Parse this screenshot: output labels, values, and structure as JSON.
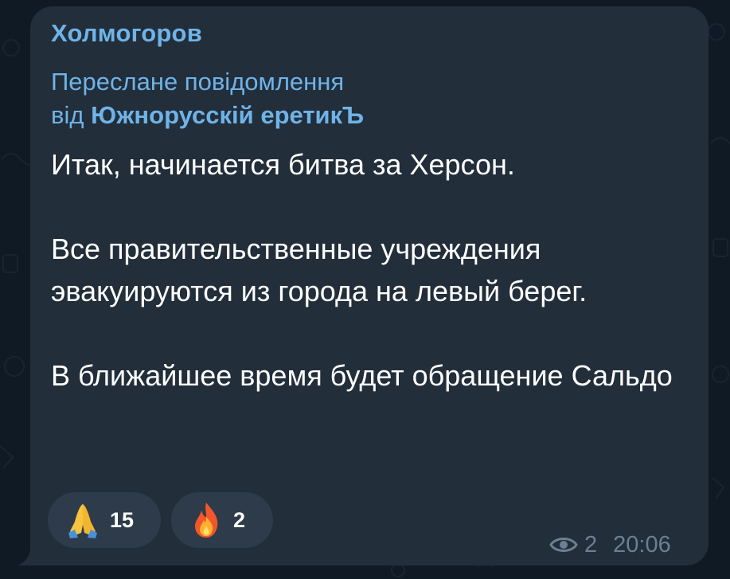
{
  "message": {
    "sender_name": "Холмогоров",
    "forward_label": "Переслане повідомлення",
    "forward_from_prefix": "від",
    "forward_from_name": "Южнорусскій еретикЪ",
    "text": "Итак, начинается битва за Херсон.\n\nВсе правительственные учреждения эвакуируются из города на левый берег.\n\nВ ближайшее время будет обращение Сальдо"
  },
  "reactions": [
    {
      "emoji": "folded-hands-icon",
      "count": "15"
    },
    {
      "emoji": "fire-icon",
      "count": "2"
    }
  ],
  "meta": {
    "views": "2",
    "time": "20:06",
    "views_icon": "eye-icon"
  },
  "colors": {
    "background": "#0f1a24",
    "bubble": "#222e3a",
    "accent": "#6fb3e8",
    "text": "#ffffff",
    "meta": "#6d7f90",
    "reaction_bg": "#2d3b4a"
  }
}
